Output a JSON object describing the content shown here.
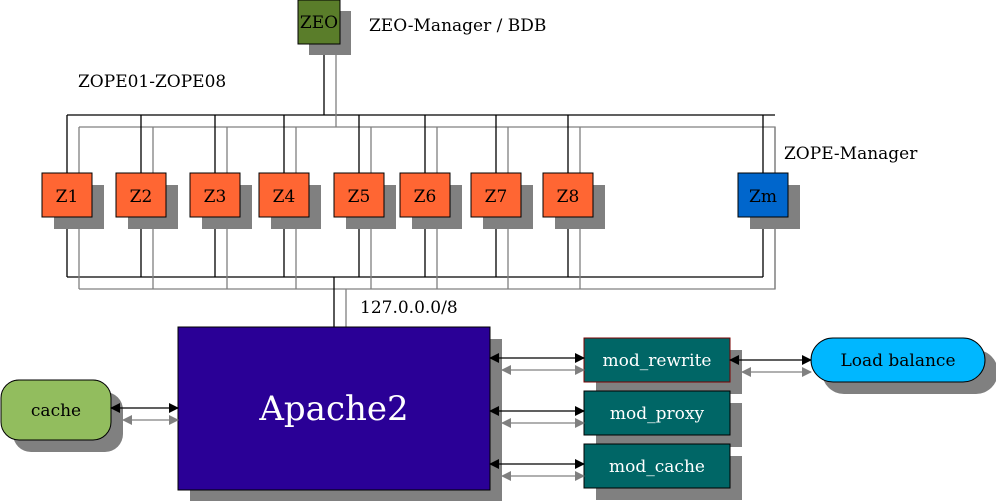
{
  "diagram": {
    "labels": {
      "zeo_manager": "ZEO-Manager / BDB",
      "zope_range": "ZOPE01-ZOPE08",
      "zope_manager": "ZOPE-Manager",
      "network": "127.0.0.0/8"
    },
    "zeo": {
      "label": "ZEO",
      "color": "#5a7d2a"
    },
    "zope_nodes": [
      {
        "label": "Z1",
        "color": "#ff6633"
      },
      {
        "label": "Z2",
        "color": "#ff6633"
      },
      {
        "label": "Z3",
        "color": "#ff6633"
      },
      {
        "label": "Z4",
        "color": "#ff6633"
      },
      {
        "label": "Z5",
        "color": "#ff6633"
      },
      {
        "label": "Z6",
        "color": "#ff6633"
      },
      {
        "label": "Z7",
        "color": "#ff6633"
      },
      {
        "label": "Z8",
        "color": "#ff6633"
      }
    ],
    "zope_manager_node": {
      "label": "Zm",
      "color": "#0066cc"
    },
    "apache": {
      "label": "Apache2",
      "color": "#2a0096"
    },
    "cache": {
      "label": "cache",
      "color": "#92bd5e"
    },
    "modules": [
      {
        "label": "mod_rewrite",
        "color": "#006666"
      },
      {
        "label": "mod_proxy",
        "color": "#006666"
      },
      {
        "label": "mod_cache",
        "color": "#006666"
      }
    ],
    "load_balance": {
      "label": "Load balance",
      "color": "#00b7ff"
    },
    "shadow_color": "#808080",
    "edge_color": "#000000",
    "edge_secondary_color": "#808080"
  }
}
